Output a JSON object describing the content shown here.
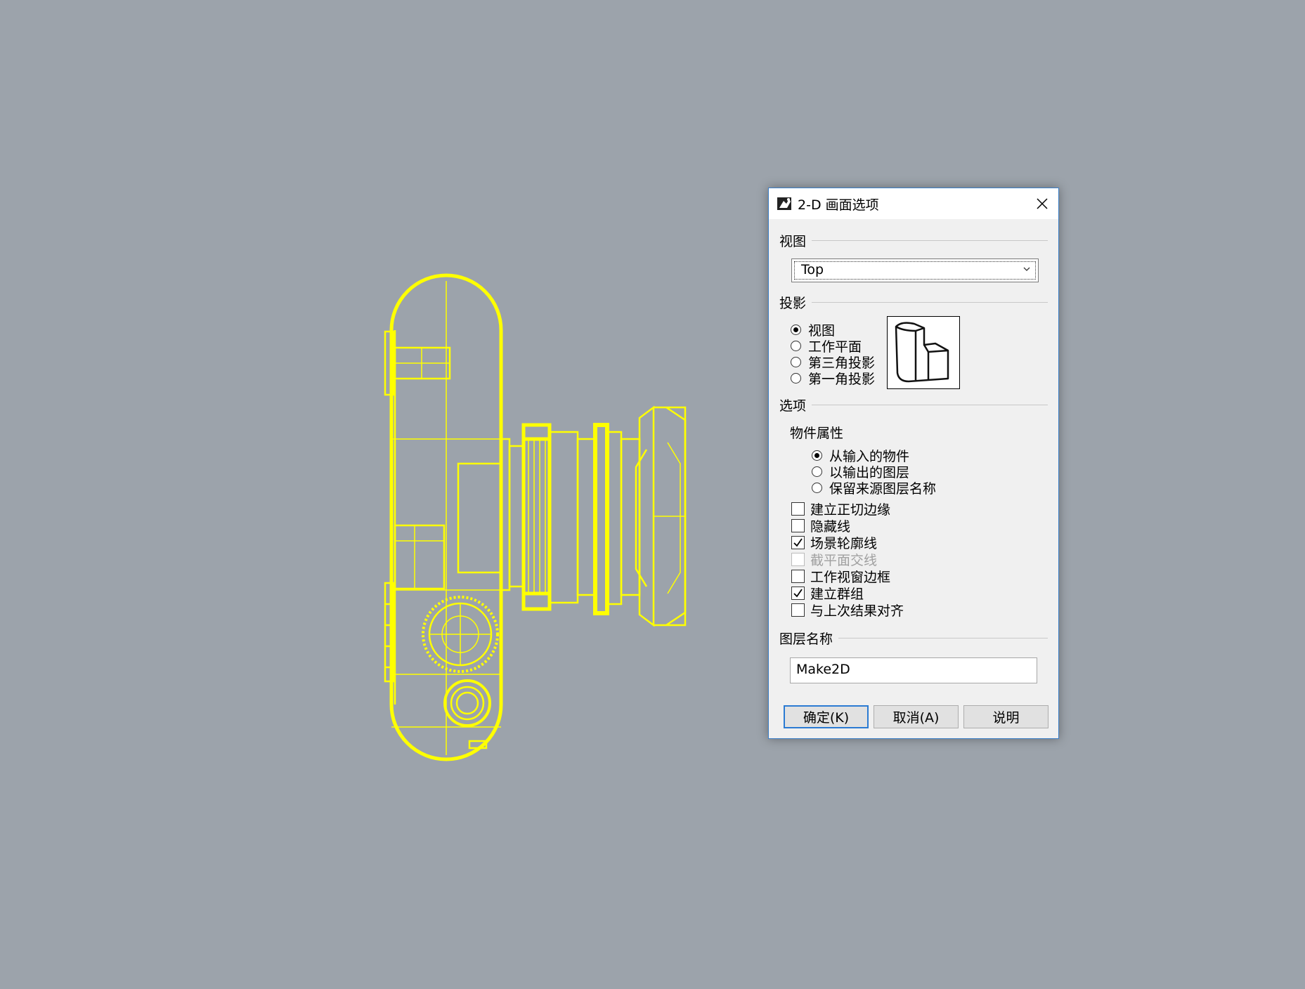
{
  "colors": {
    "wireframe": "#ffff00",
    "background": "#9ca3ab",
    "annotation_arrow": "#ff1e1e",
    "default_button_border": "#2b7bd3"
  },
  "dialog": {
    "title": "2-D 画面选项",
    "title_icon": "rhino-icon",
    "sections": {
      "view": "视图",
      "projection": "投影",
      "options": "选项",
      "layer_name": "图层名称"
    },
    "view_select": {
      "value": "Top"
    },
    "projection_options": [
      {
        "label": "视图",
        "selected": true
      },
      {
        "label": "工作平面",
        "selected": false
      },
      {
        "label": "第三角投影",
        "selected": false
      },
      {
        "label": "第一角投影",
        "selected": false
      }
    ],
    "object_properties_label": "物件属性",
    "object_properties_options": [
      {
        "label": "从输入的物件",
        "selected": true
      },
      {
        "label": "以输出的图层",
        "selected": false
      },
      {
        "label": "保留来源图层名称",
        "selected": false
      }
    ],
    "checkboxes": [
      {
        "label": "建立正切边缘",
        "checked": false,
        "enabled": true
      },
      {
        "label": "隐藏线",
        "checked": false,
        "enabled": true
      },
      {
        "label": "场景轮廓线",
        "checked": true,
        "enabled": true
      },
      {
        "label": "截平面交线",
        "checked": false,
        "enabled": false
      },
      {
        "label": "工作视窗边框",
        "checked": false,
        "enabled": true
      },
      {
        "label": "建立群组",
        "checked": true,
        "enabled": true
      },
      {
        "label": "与上次结果对齐",
        "checked": false,
        "enabled": true
      }
    ],
    "layer_name_value": "Make2D",
    "buttons": {
      "ok": "确定(K)",
      "cancel": "取消(A)",
      "help": "说明"
    }
  }
}
